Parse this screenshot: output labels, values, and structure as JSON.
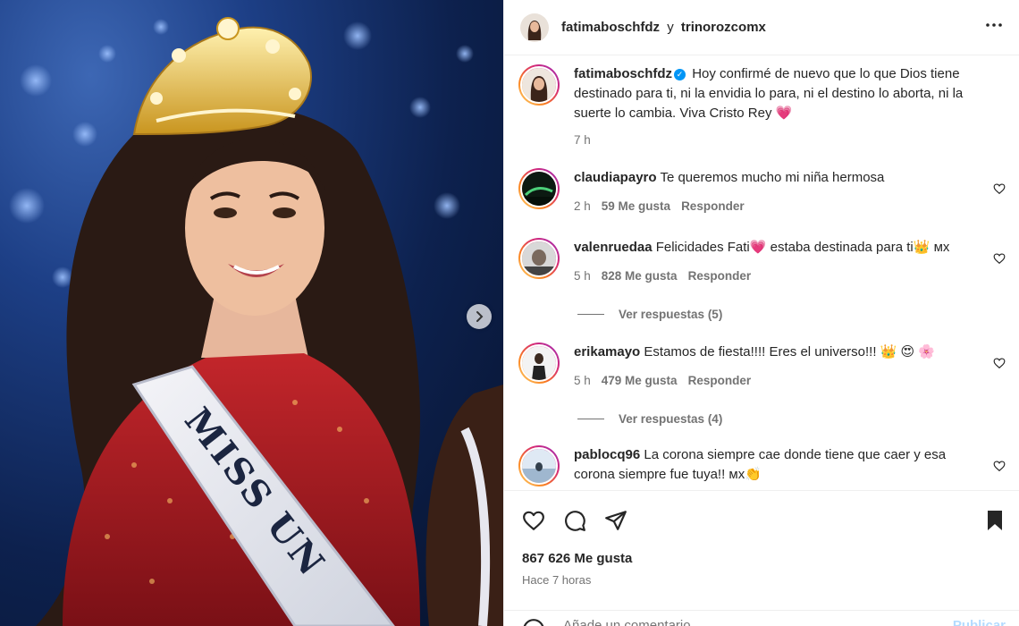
{
  "header": {
    "author": "fatimaboschfdz",
    "connector": "y",
    "coauthor": "trinorozcomx",
    "more_icon": "more-horizontal-icon"
  },
  "caption": {
    "username": "fatimaboschfdz",
    "verified": true,
    "text": "Hoy confirmé de nuevo que lo que Dios tiene destinado para ti, ni la envidia lo para, ni el destino lo aborta, ni la suerte lo cambia. Viva Cristo Rey 💗",
    "time": "7 h"
  },
  "comments": [
    {
      "username": "claudiapayro",
      "text": "Te queremos mucho mi niña hermosa",
      "time": "2 h",
      "likes": "59 Me gusta",
      "reply": "Responder",
      "replies": ""
    },
    {
      "username": "valenruedaa",
      "text": "Felicidades Fati💗 estaba destinada para ti👑 ᴍx",
      "time": "5 h",
      "likes": "828 Me gusta",
      "reply": "Responder",
      "replies": "Ver respuestas (5)"
    },
    {
      "username": "erikamayo",
      "text": "Estamos de fiesta!!!! Eres el universo!!! 👑 😍 🌸",
      "time": "5 h",
      "likes": "479 Me gusta",
      "reply": "Responder",
      "replies": "Ver respuestas (4)"
    },
    {
      "username": "pablocq96",
      "text": "La corona siempre cae donde tiene que caer y esa corona siempre fue tuya!! ᴍx👏",
      "time": "",
      "likes": "",
      "reply": "",
      "replies": ""
    }
  ],
  "actions": {
    "likes": "867 626 Me gusta",
    "time": "Hace 7 horas"
  },
  "add_comment": {
    "placeholder": "Añade un comentario...",
    "post": "Publicar"
  },
  "image": {
    "sash_text": "MISS UN",
    "next_icon": "chevron-right-icon"
  },
  "colors": {
    "accent": "#0095f6",
    "muted": "#737373",
    "text": "#262626"
  }
}
